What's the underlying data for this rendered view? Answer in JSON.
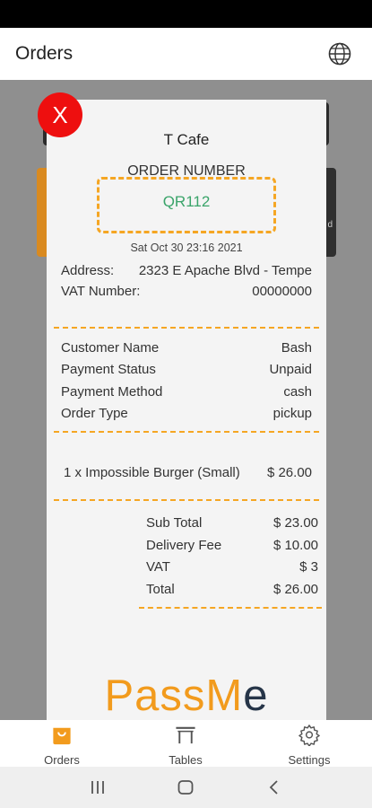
{
  "header": {
    "title": "Orders",
    "language_icon": "globe-icon"
  },
  "background": {
    "right_card_fragment": "d"
  },
  "receipt": {
    "close_label": "X",
    "cafe_name": "T Cafe",
    "order_number_label": "ORDER NUMBER",
    "order_number": "QR112",
    "date": "Sat Oct 30 23:16 2021",
    "address_label": "Address:",
    "address_value": "2323 E Apache Blvd - Tempe",
    "vat_number_label": "VAT Number:",
    "vat_number_value": "00000000",
    "details": [
      {
        "label": "Customer Name",
        "value": "Bash"
      },
      {
        "label": "Payment Status",
        "value": "Unpaid"
      },
      {
        "label": "Payment Method",
        "value": "cash"
      },
      {
        "label": "Order Type",
        "value": "pickup"
      }
    ],
    "items": [
      {
        "description": "1 x Impossible Burger (Small)",
        "price": "$ 26.00"
      }
    ],
    "summary": [
      {
        "label": "Sub Total",
        "value": "$ 23.00"
      },
      {
        "label": "Delivery Fee",
        "value": "$ 10.00"
      },
      {
        "label": "VAT",
        "value": "$ 3"
      },
      {
        "label": "Total",
        "value": "$ 26.00"
      }
    ],
    "brand_part1": "Pass",
    "brand_part2": "M",
    "brand_part3": "e"
  },
  "bottom_nav": {
    "items": [
      {
        "label": "Orders",
        "icon": "bag-icon",
        "active": true
      },
      {
        "label": "Tables",
        "icon": "table-icon",
        "active": false
      },
      {
        "label": "Settings",
        "icon": "gear-icon",
        "active": false
      }
    ]
  },
  "system_nav": {
    "icons": [
      "recents-icon",
      "home-icon",
      "back-icon"
    ]
  },
  "colors": {
    "accent": "#f5a623",
    "order_number": "#3aa46a",
    "close": "#ee0f0f",
    "brand_dark": "#263548"
  }
}
